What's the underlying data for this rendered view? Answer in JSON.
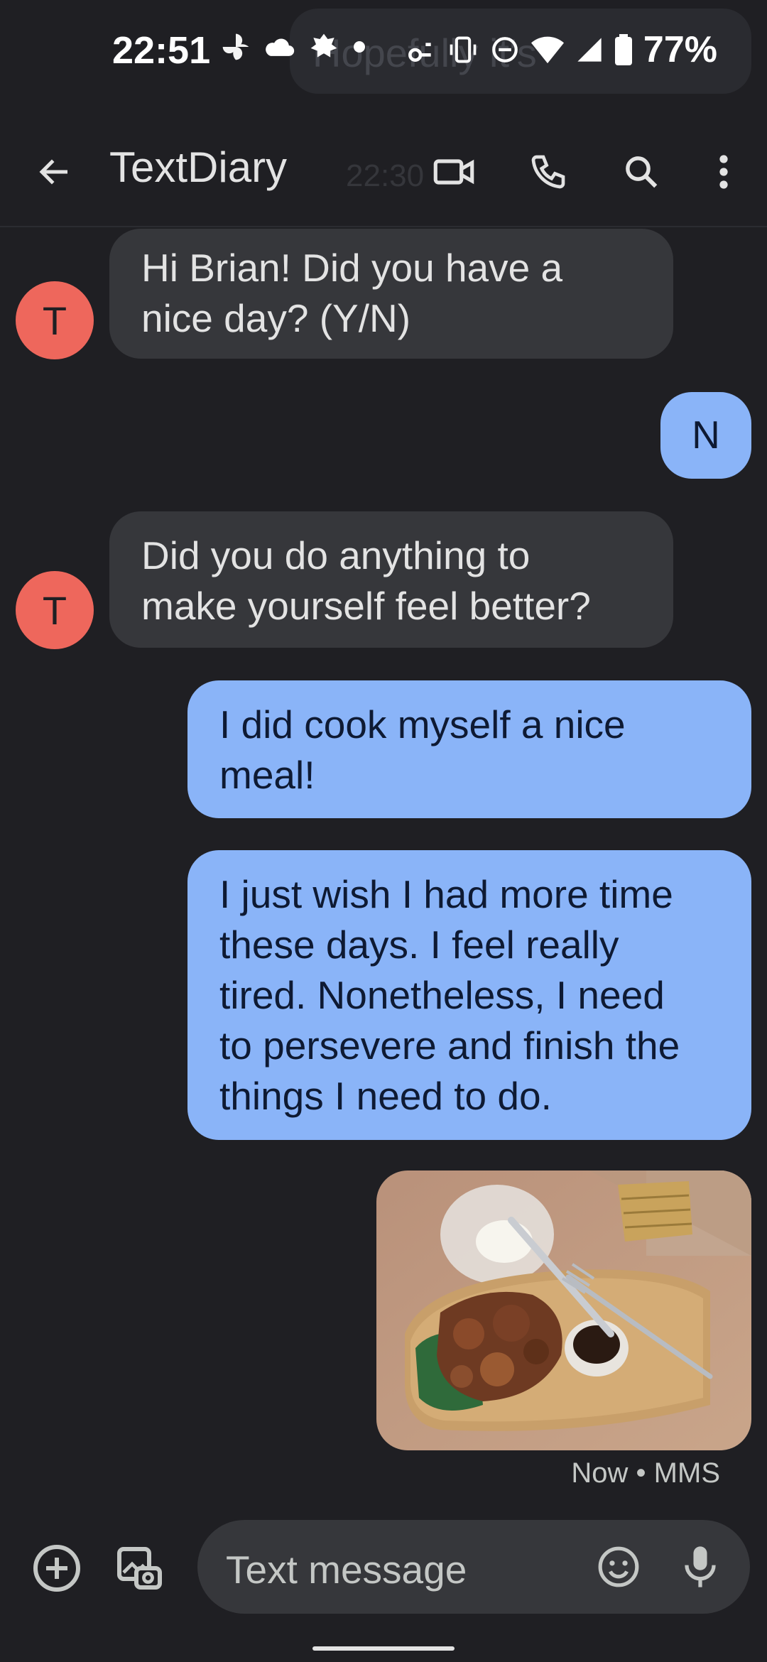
{
  "status_bar": {
    "time": "22:51",
    "battery": "77%",
    "ghost_notification": "Hopefully it's"
  },
  "header": {
    "back_icon": "arrow-back-icon",
    "title": "TextDiary",
    "ghost_time": "22:30",
    "actions": [
      "video-call-icon",
      "phone-icon",
      "search-icon",
      "more-vert-icon"
    ]
  },
  "messages": [
    {
      "from": "bot",
      "avatar": "T",
      "text_lines": [
        "Hi Brian! Did you have a",
        "nice day? (Y/N)"
      ]
    },
    {
      "from": "me",
      "text_lines": [
        "N"
      ]
    },
    {
      "from": "bot",
      "avatar": "T",
      "text_lines": [
        "Did you do anything to",
        "make yourself feel better?"
      ]
    },
    {
      "from": "me",
      "text_lines": [
        "I did cook myself a nice",
        "meal!"
      ]
    },
    {
      "from": "me",
      "text_lines": [
        "I just wish I had more time",
        "these days. I feel really",
        "tired. Nonetheless, I need",
        "to persevere and finish the",
        "things I need to do."
      ]
    },
    {
      "from": "me",
      "type": "image",
      "alt": "meal photo"
    }
  ],
  "message_meta": "Now • MMS",
  "composer": {
    "placeholder": "Text message",
    "icons": [
      "add-icon",
      "gallery-icon",
      "emoji-icon",
      "mic-icon"
    ]
  },
  "colors": {
    "background": "#1f1f23",
    "incoming_bubble": "#36373b",
    "outgoing_bubble": "#8ab4f8",
    "avatar": "#ee675c"
  }
}
